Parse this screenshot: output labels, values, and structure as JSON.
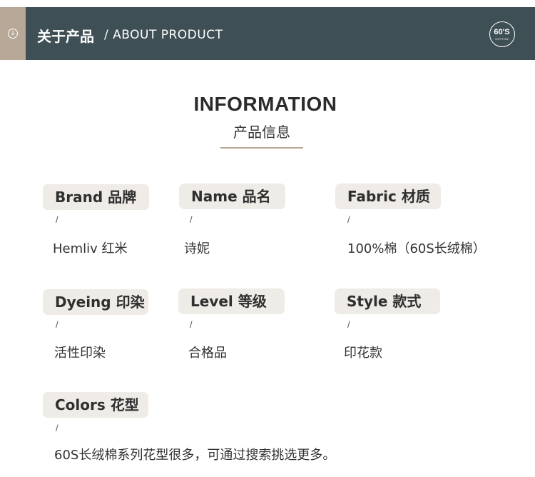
{
  "header": {
    "icon": "arrow-down-circle-icon",
    "title": "关于产品",
    "subtitle": "/ ABOUT PRODUCT",
    "badge": {
      "main": "60'S",
      "sub": "COTTON"
    }
  },
  "section": {
    "title": "INFORMATION",
    "subtitle": "产品信息",
    "accent_color": "#b5a58f"
  },
  "fields": [
    {
      "label": "Brand 品牌",
      "separator": "/",
      "value": "Hemliv 红米"
    },
    {
      "label": "Name 品名",
      "separator": "/",
      "value": "诗妮"
    },
    {
      "label": "Fabric 材质",
      "separator": "/",
      "value": "100%棉（60S长绒棉）"
    },
    {
      "label": "Dyeing 印染",
      "separator": "/",
      "value": "活性印染"
    },
    {
      "label": "Level 等级",
      "separator": "/",
      "value": "合格品"
    },
    {
      "label": "Style 款式",
      "separator": "/",
      "value": "印花款"
    },
    {
      "label": "Colors 花型",
      "separator": "/",
      "value": "60S长绒棉系列花型很多，可通过搜索挑选更多。"
    }
  ],
  "colors": {
    "banner": "#3e4f55",
    "banner_tab": "#b8a898",
    "label_bg": "#efebe6"
  }
}
